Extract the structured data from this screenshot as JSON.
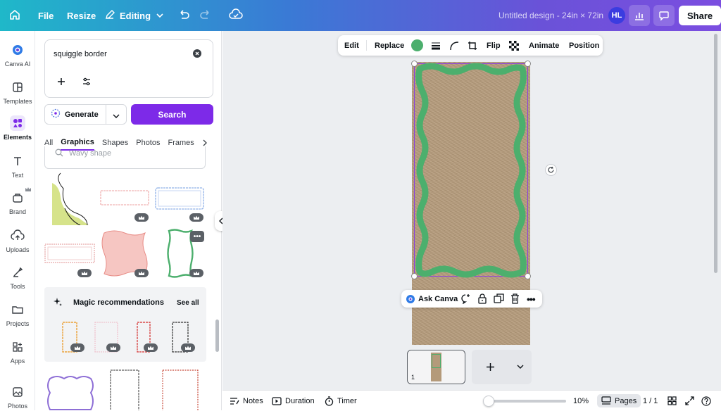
{
  "topbar": {
    "file_label": "File",
    "resize_label": "Resize",
    "editing_label": "Editing",
    "design_title": "Untitled design - 24in × 72in",
    "avatar_initials": "HL",
    "share_label": "Share"
  },
  "rail": {
    "items": [
      {
        "label": "Canva AI",
        "icon": "canva-ai-icon"
      },
      {
        "label": "Templates",
        "icon": "templates-icon"
      },
      {
        "label": "Elements",
        "icon": "elements-icon"
      },
      {
        "label": "Text",
        "icon": "text-icon"
      },
      {
        "label": "Brand",
        "icon": "brand-icon"
      },
      {
        "label": "Uploads",
        "icon": "uploads-icon"
      },
      {
        "label": "Tools",
        "icon": "tools-icon"
      },
      {
        "label": "Projects",
        "icon": "projects-icon"
      },
      {
        "label": "Apps",
        "icon": "apps-icon"
      },
      {
        "label": "Photos",
        "icon": "photos-icon"
      }
    ]
  },
  "panel": {
    "search_value": "squiggle border",
    "generate_label": "Generate",
    "search_button": "Search",
    "tabs": [
      "All",
      "Graphics",
      "Shapes",
      "Photos",
      "Frames"
    ],
    "active_tab": "Graphics",
    "subsearch_placeholder": "Wavy shape",
    "magic_title": "Magic recommendations",
    "see_all": "See all"
  },
  "context_toolbar": {
    "edit": "Edit",
    "replace": "Replace",
    "flip": "Flip",
    "animate": "Animate",
    "position": "Position",
    "color": "#4caf6d"
  },
  "action_bar": {
    "ask_canva": "Ask Canva"
  },
  "bottombar": {
    "notes": "Notes",
    "duration": "Duration",
    "timer": "Timer",
    "zoom": "10%",
    "pages": "Pages",
    "page_count": "1 / 1",
    "page_number": "1"
  },
  "colors": {
    "accent": "#7d2ae8",
    "border_green": "#4caf6d",
    "kraft": "#b49a7a"
  }
}
